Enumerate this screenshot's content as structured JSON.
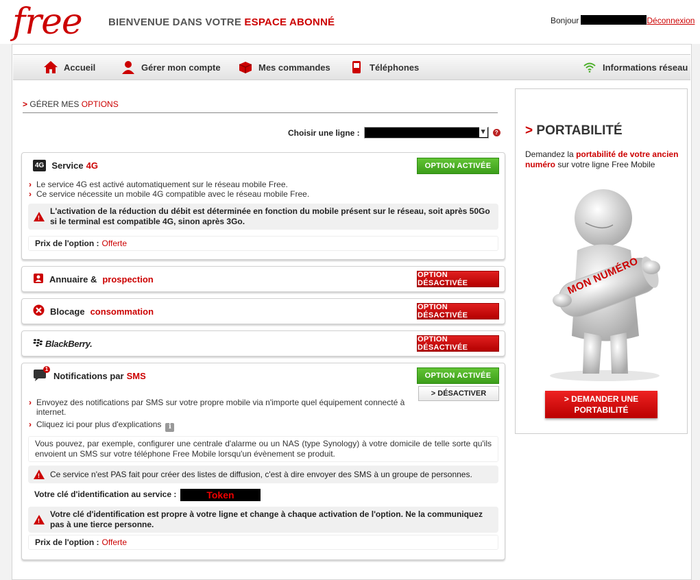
{
  "header": {
    "logo_text": "free",
    "welcome_prefix": "BIENVENUE DANS VOTRE",
    "welcome_highlight": "ESPACE ABONNÉ",
    "greeting": "Bonjour",
    "logout_label": "Déconnexion"
  },
  "nav": {
    "items": [
      {
        "label": "Accueil",
        "icon": "home-icon"
      },
      {
        "label": "Gérer mon compte",
        "icon": "user-icon"
      },
      {
        "label": "Mes commandes",
        "icon": "box-icon"
      },
      {
        "label": "Téléphones",
        "icon": "phone-icon"
      }
    ],
    "network_label": "Informations réseau"
  },
  "main": {
    "section_arrow": ">",
    "section_title_plain": "GÉRER MES",
    "section_title_red": "OPTIONS",
    "choose_line_label": "Choisir une ligne :",
    "help_icon": "?"
  },
  "colors": {
    "brand_red": "#cc0000",
    "active_green": "#4caf2a"
  },
  "options": {
    "service4g": {
      "badge": "4G",
      "title_plain": "Service",
      "title_red": "4G",
      "status": "OPTION ACTIVÉE",
      "bullets": [
        "Le service 4G est activé automatiquement sur le réseau mobile Free.",
        "Ce service nécessite un mobile 4G compatible avec le réseau mobile Free."
      ],
      "warning": "L'activation de la réduction du débit est déterminée en fonction du mobile présent sur le réseau, soit après 50Go si le terminal est compatible 4G, sinon après 3Go.",
      "price_label": "Prix de l'option :",
      "price_value": "Offerte"
    },
    "annuaire": {
      "title_plain": "Annuaire &",
      "title_red": "prospection",
      "status": "OPTION DÉSACTIVÉE"
    },
    "blocage": {
      "title_plain": "Blocage",
      "title_red": "consommation",
      "status": "OPTION DÉSACTIVÉE"
    },
    "blackberry": {
      "title": "BlackBerry.",
      "status": "OPTION DÉSACTIVÉE"
    },
    "sms": {
      "badge_count": "1",
      "title_plain": "Notifications par",
      "title_red": "SMS",
      "status": "OPTION ACTIVÉE",
      "deactivate_label": "> DÉSACTIVER",
      "bullets": [
        "Envoyez des notifications par SMS sur votre propre mobile via n'importe quel équipement connecté à internet.",
        "Cliquez ici pour plus d'explications"
      ],
      "info": "Vous pouvez, par exemple, configurer une centrale d'alarme ou un NAS (type Synology) à votre domicile de telle sorte qu'ils envoient un SMS sur votre téléphone Free Mobile lorsqu'un évènement se produit.",
      "warning1": "Ce service n'est PAS fait pour créer des listes de diffusion, c'est à dire envoyer des SMS à un groupe de personnes.",
      "key_label": "Votre clé d'identification au service :",
      "key_value": "Token",
      "warning2": "Votre clé d'identification est propre à votre ligne et change à chaque activation de l'option. Ne la communiquez pas à une tierce personne.",
      "price_label": "Prix de l'option :",
      "price_value": "Offerte"
    }
  },
  "sidebar": {
    "title_arrow": ">",
    "title": "PORTABILITÉ",
    "text_before": "Demandez la",
    "text_red": "portabilité de votre ancien numéro",
    "text_after": "sur votre ligne Free Mobile",
    "illustration_label": "MON NUMÉRO",
    "button_label": "> DEMANDER UNE PORTABILITÉ"
  }
}
